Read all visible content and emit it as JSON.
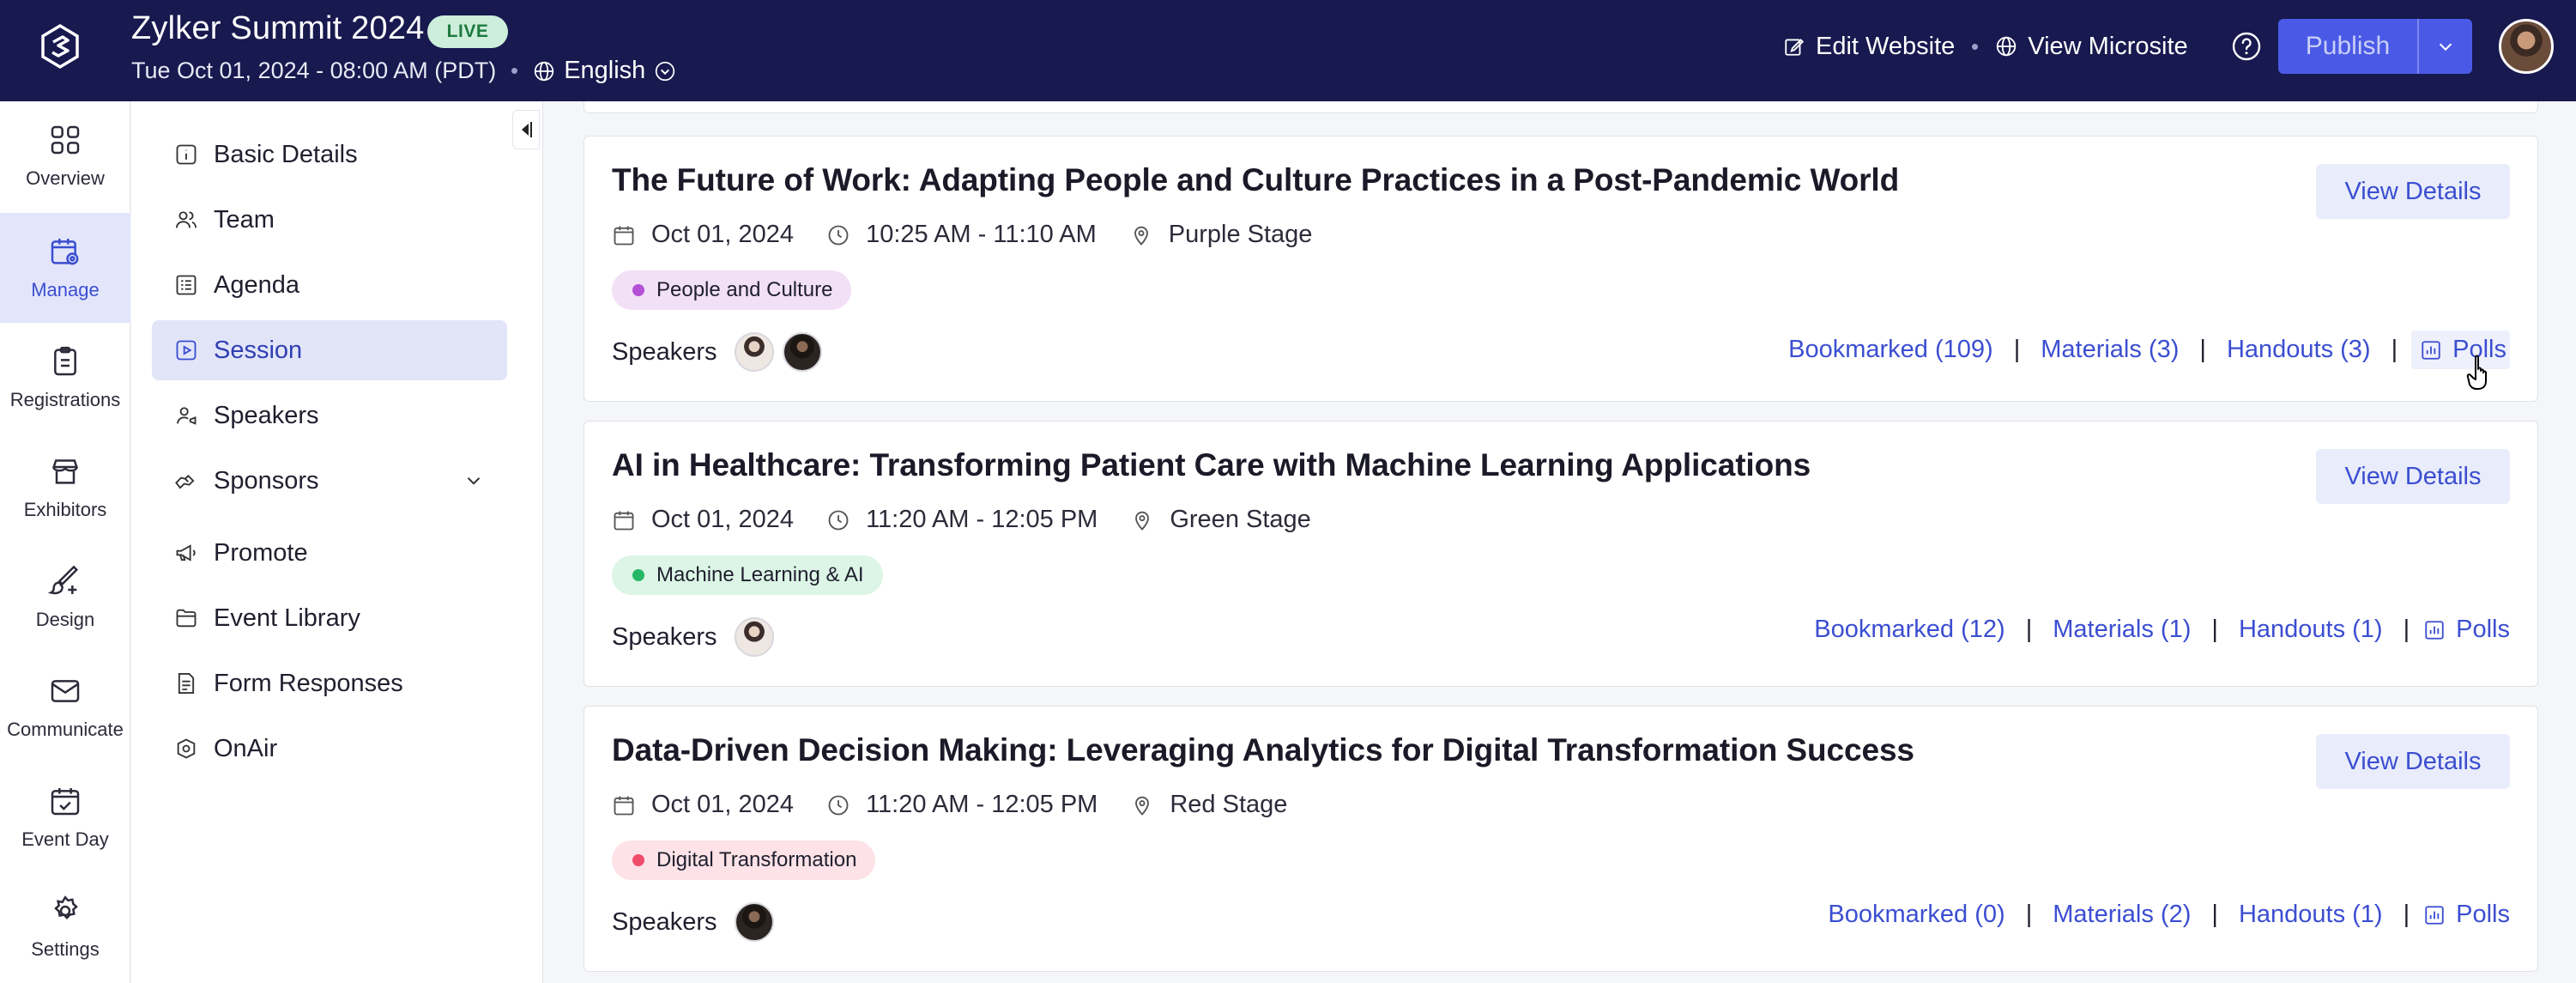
{
  "header": {
    "event_title": "Zylker Summit 2024",
    "live_badge": "LIVE",
    "datetime": "Tue Oct 01, 2024 - 08:00 AM (PDT)",
    "language": "English",
    "edit_website": "Edit Website",
    "view_microsite": "View Microsite",
    "publish": "Publish"
  },
  "rail": [
    {
      "label": "Overview",
      "icon": "grid-icon"
    },
    {
      "label": "Manage",
      "icon": "calendar-gear-icon",
      "active": true
    },
    {
      "label": "Registrations",
      "icon": "clipboard-icon"
    },
    {
      "label": "Exhibitors",
      "icon": "booth-icon"
    },
    {
      "label": "Design",
      "icon": "brush-icon"
    },
    {
      "label": "Communicate",
      "icon": "mail-icon"
    },
    {
      "label": "Event Day",
      "icon": "calendar-check-icon"
    },
    {
      "label": "Settings",
      "icon": "gear-icon"
    }
  ],
  "nav": [
    {
      "label": "Basic Details"
    },
    {
      "label": "Team"
    },
    {
      "label": "Agenda"
    },
    {
      "label": "Session",
      "active": true
    },
    {
      "label": "Speakers"
    },
    {
      "label": "Sponsors"
    },
    {
      "label": "Promote"
    },
    {
      "label": "Event Library"
    },
    {
      "label": "Form Responses"
    },
    {
      "label": "OnAir"
    }
  ],
  "sessions": [
    {
      "title": "The Future of Work: Adapting People and Culture Practices in a Post-Pandemic World",
      "date": "Oct 01, 2024",
      "time": "10:25 AM - 11:10 AM",
      "stage": "Purple Stage",
      "tag": "People and Culture",
      "tag_color": "#b44fd6",
      "tag_bg": "#f2e0f7",
      "speakers_label": "Speakers",
      "view_details": "View Details",
      "bookmarked": "Bookmarked (109)",
      "materials": "Materials (3)",
      "handouts": "Handouts (3)",
      "polls": "Polls"
    },
    {
      "title": "AI in Healthcare: Transforming Patient Care with Machine Learning Applications",
      "date": "Oct 01, 2024",
      "time": "11:20 AM - 12:05 PM",
      "stage": "Green Stage",
      "tag": "Machine Learning & AI",
      "tag_color": "#25b765",
      "tag_bg": "#dcf5e6",
      "speakers_label": "Speakers",
      "view_details": "View Details",
      "bookmarked": "Bookmarked (12)",
      "materials": "Materials (1)",
      "handouts": "Handouts (1)",
      "polls": "Polls"
    },
    {
      "title": "Data-Driven Decision Making: Leveraging Analytics for Digital Transformation Success",
      "date": "Oct 01, 2024",
      "time": "11:20 AM - 12:05 PM",
      "stage": "Red Stage",
      "tag": "Digital Transformation",
      "tag_color": "#ef4c6b",
      "tag_bg": "#fde2e7",
      "speakers_label": "Speakers",
      "view_details": "View Details",
      "bookmarked": "Bookmarked (0)",
      "materials": "Materials (2)",
      "handouts": "Handouts (1)",
      "polls": "Polls"
    }
  ]
}
